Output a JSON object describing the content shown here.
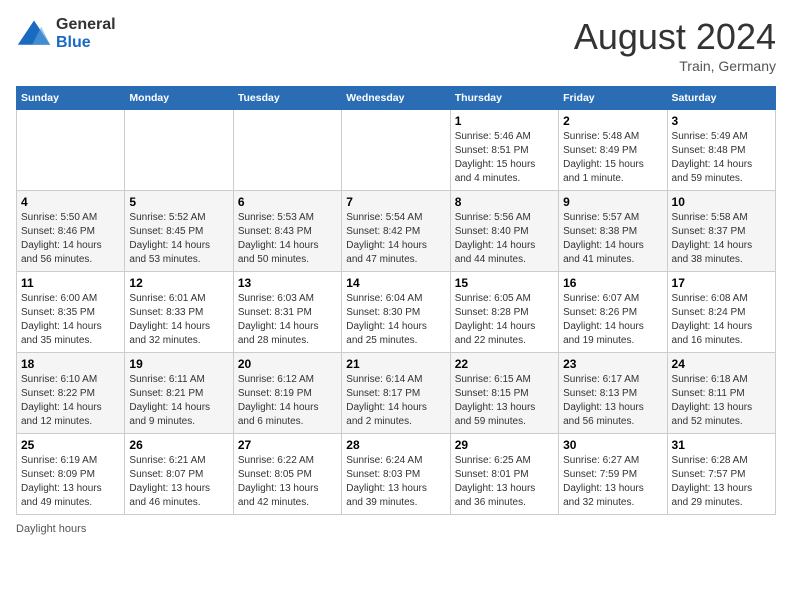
{
  "header": {
    "logo_general": "General",
    "logo_blue": "Blue",
    "month_title": "August 2024",
    "location": "Train, Germany"
  },
  "footer": {
    "daylight_label": "Daylight hours"
  },
  "weekdays": [
    "Sunday",
    "Monday",
    "Tuesday",
    "Wednesday",
    "Thursday",
    "Friday",
    "Saturday"
  ],
  "weeks": [
    [
      {
        "day": "",
        "info": ""
      },
      {
        "day": "",
        "info": ""
      },
      {
        "day": "",
        "info": ""
      },
      {
        "day": "",
        "info": ""
      },
      {
        "day": "1",
        "info": "Sunrise: 5:46 AM\nSunset: 8:51 PM\nDaylight: 15 hours and 4 minutes."
      },
      {
        "day": "2",
        "info": "Sunrise: 5:48 AM\nSunset: 8:49 PM\nDaylight: 15 hours and 1 minute."
      },
      {
        "day": "3",
        "info": "Sunrise: 5:49 AM\nSunset: 8:48 PM\nDaylight: 14 hours and 59 minutes."
      }
    ],
    [
      {
        "day": "4",
        "info": "Sunrise: 5:50 AM\nSunset: 8:46 PM\nDaylight: 14 hours and 56 minutes."
      },
      {
        "day": "5",
        "info": "Sunrise: 5:52 AM\nSunset: 8:45 PM\nDaylight: 14 hours and 53 minutes."
      },
      {
        "day": "6",
        "info": "Sunrise: 5:53 AM\nSunset: 8:43 PM\nDaylight: 14 hours and 50 minutes."
      },
      {
        "day": "7",
        "info": "Sunrise: 5:54 AM\nSunset: 8:42 PM\nDaylight: 14 hours and 47 minutes."
      },
      {
        "day": "8",
        "info": "Sunrise: 5:56 AM\nSunset: 8:40 PM\nDaylight: 14 hours and 44 minutes."
      },
      {
        "day": "9",
        "info": "Sunrise: 5:57 AM\nSunset: 8:38 PM\nDaylight: 14 hours and 41 minutes."
      },
      {
        "day": "10",
        "info": "Sunrise: 5:58 AM\nSunset: 8:37 PM\nDaylight: 14 hours and 38 minutes."
      }
    ],
    [
      {
        "day": "11",
        "info": "Sunrise: 6:00 AM\nSunset: 8:35 PM\nDaylight: 14 hours and 35 minutes."
      },
      {
        "day": "12",
        "info": "Sunrise: 6:01 AM\nSunset: 8:33 PM\nDaylight: 14 hours and 32 minutes."
      },
      {
        "day": "13",
        "info": "Sunrise: 6:03 AM\nSunset: 8:31 PM\nDaylight: 14 hours and 28 minutes."
      },
      {
        "day": "14",
        "info": "Sunrise: 6:04 AM\nSunset: 8:30 PM\nDaylight: 14 hours and 25 minutes."
      },
      {
        "day": "15",
        "info": "Sunrise: 6:05 AM\nSunset: 8:28 PM\nDaylight: 14 hours and 22 minutes."
      },
      {
        "day": "16",
        "info": "Sunrise: 6:07 AM\nSunset: 8:26 PM\nDaylight: 14 hours and 19 minutes."
      },
      {
        "day": "17",
        "info": "Sunrise: 6:08 AM\nSunset: 8:24 PM\nDaylight: 14 hours and 16 minutes."
      }
    ],
    [
      {
        "day": "18",
        "info": "Sunrise: 6:10 AM\nSunset: 8:22 PM\nDaylight: 14 hours and 12 minutes."
      },
      {
        "day": "19",
        "info": "Sunrise: 6:11 AM\nSunset: 8:21 PM\nDaylight: 14 hours and 9 minutes."
      },
      {
        "day": "20",
        "info": "Sunrise: 6:12 AM\nSunset: 8:19 PM\nDaylight: 14 hours and 6 minutes."
      },
      {
        "day": "21",
        "info": "Sunrise: 6:14 AM\nSunset: 8:17 PM\nDaylight: 14 hours and 2 minutes."
      },
      {
        "day": "22",
        "info": "Sunrise: 6:15 AM\nSunset: 8:15 PM\nDaylight: 13 hours and 59 minutes."
      },
      {
        "day": "23",
        "info": "Sunrise: 6:17 AM\nSunset: 8:13 PM\nDaylight: 13 hours and 56 minutes."
      },
      {
        "day": "24",
        "info": "Sunrise: 6:18 AM\nSunset: 8:11 PM\nDaylight: 13 hours and 52 minutes."
      }
    ],
    [
      {
        "day": "25",
        "info": "Sunrise: 6:19 AM\nSunset: 8:09 PM\nDaylight: 13 hours and 49 minutes."
      },
      {
        "day": "26",
        "info": "Sunrise: 6:21 AM\nSunset: 8:07 PM\nDaylight: 13 hours and 46 minutes."
      },
      {
        "day": "27",
        "info": "Sunrise: 6:22 AM\nSunset: 8:05 PM\nDaylight: 13 hours and 42 minutes."
      },
      {
        "day": "28",
        "info": "Sunrise: 6:24 AM\nSunset: 8:03 PM\nDaylight: 13 hours and 39 minutes."
      },
      {
        "day": "29",
        "info": "Sunrise: 6:25 AM\nSunset: 8:01 PM\nDaylight: 13 hours and 36 minutes."
      },
      {
        "day": "30",
        "info": "Sunrise: 6:27 AM\nSunset: 7:59 PM\nDaylight: 13 hours and 32 minutes."
      },
      {
        "day": "31",
        "info": "Sunrise: 6:28 AM\nSunset: 7:57 PM\nDaylight: 13 hours and 29 minutes."
      }
    ]
  ]
}
